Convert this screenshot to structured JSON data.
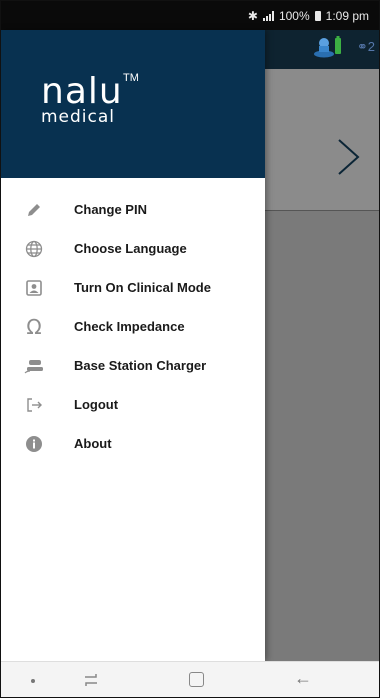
{
  "status_bar": {
    "battery": "100%",
    "time": "1:09 pm"
  },
  "drawer": {
    "logo": {
      "brand": "nalu",
      "trademark": "TM",
      "sub": "medical"
    },
    "menu": [
      {
        "label": "Change PIN",
        "icon": "pencil-icon"
      },
      {
        "label": "Choose Language",
        "icon": "globe-icon"
      },
      {
        "label": "Turn On Clinical Mode",
        "icon": "contact-card-icon"
      },
      {
        "label": "Check Impedance",
        "icon": "omega-icon"
      },
      {
        "label": "Base Station Charger",
        "icon": "charger-icon"
      },
      {
        "label": "Logout",
        "icon": "logout-icon"
      },
      {
        "label": "About",
        "icon": "info-icon"
      }
    ]
  },
  "header": {
    "pair_indicator": "2"
  },
  "colors": {
    "drawer_header": "#083150",
    "app_header": "#0e2330",
    "scrim": "#7a7a7a"
  }
}
